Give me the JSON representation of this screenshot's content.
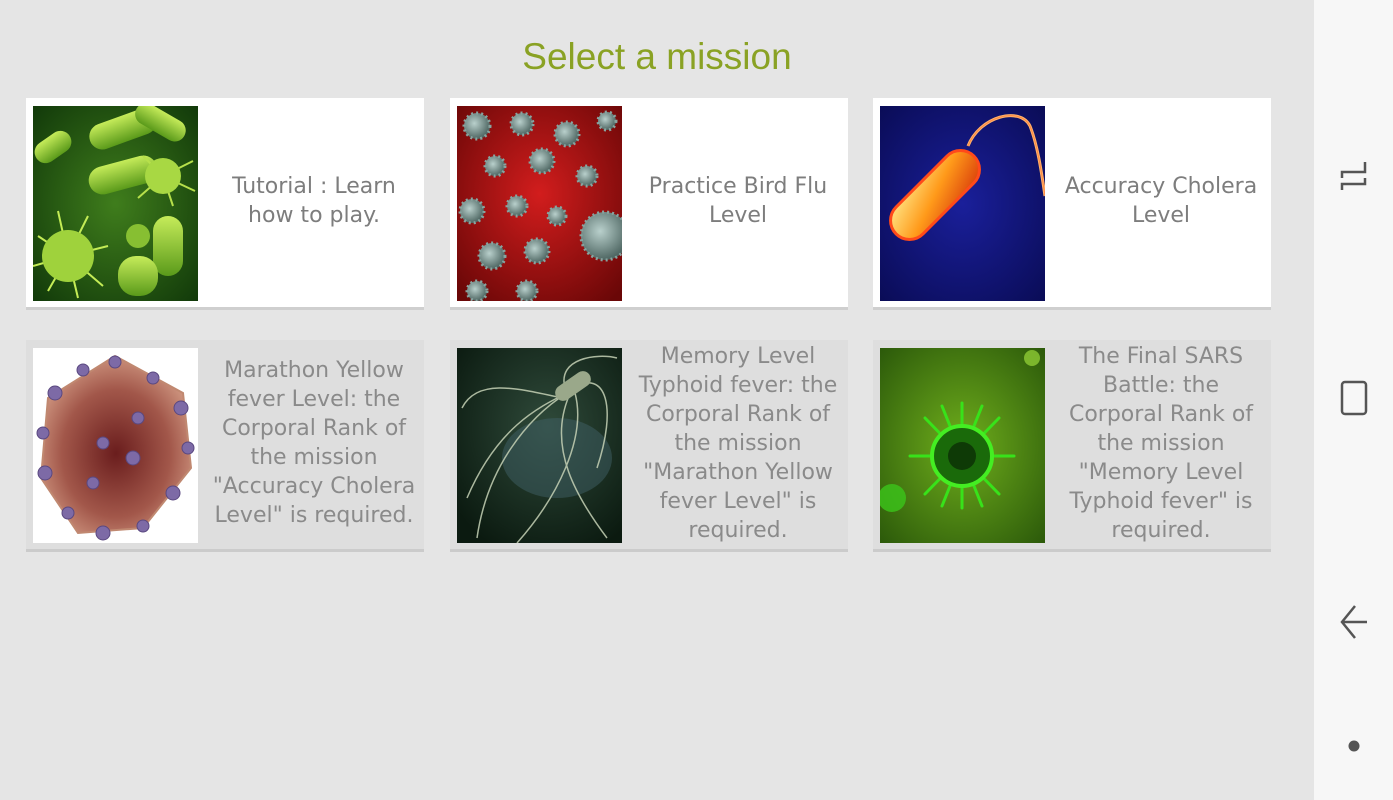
{
  "header": {
    "title": "Select a mission"
  },
  "missions": [
    {
      "label": "Tutorial : Learn how to play.",
      "image": "green-bacteria-image",
      "locked": false
    },
    {
      "label": "Practice Bird Flu Level",
      "image": "bird-flu-virus-image",
      "locked": false
    },
    {
      "label": "Accuracy Cholera Level",
      "image": "cholera-bacterium-image",
      "locked": false
    },
    {
      "label": "Marathon Yellow fever Level: the Corporal Rank of the mission \"Accuracy Cholera Level\" is required.",
      "image": "yellow-fever-virus-image",
      "locked": true
    },
    {
      "label": "Memory Level Typhoid fever: the Corporal Rank of the mission \"Marathon Yellow fever Level\" is required.",
      "image": "typhoid-bacterium-image",
      "locked": true
    },
    {
      "label": "The Final SARS Battle: the Corporal Rank of the mission \"Memory Level Typhoid fever\" is required.",
      "image": "sars-virus-image",
      "locked": true
    }
  ],
  "navbar": {
    "icons": [
      "recent-apps-icon",
      "home-icon",
      "back-icon",
      "assistant-dot-icon"
    ]
  },
  "colors": {
    "title": "#8aa224",
    "background": "#e5e5e5",
    "card": "#ffffff",
    "locked_card": "#dedede",
    "label_text": "#7d7d7d"
  }
}
